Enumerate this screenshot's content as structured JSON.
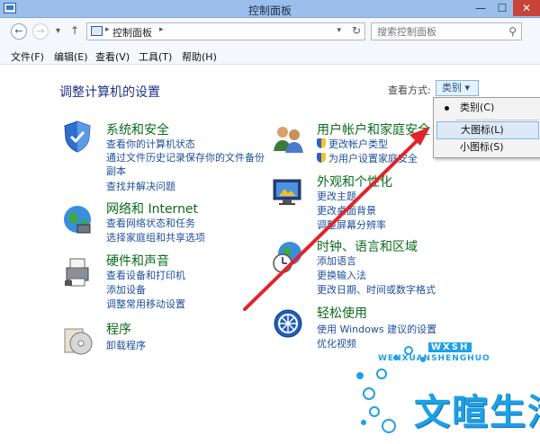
{
  "window": {
    "title": "控制面板",
    "minimize": "—",
    "maximize": "☐",
    "close": "✕"
  },
  "address": {
    "crumb": "控制面板",
    "sep1": "▸",
    "sep2": "▸"
  },
  "search": {
    "placeholder": "搜索控制面板"
  },
  "menu": {
    "file": "文件(F)",
    "edit": "编辑(E)",
    "view": "查看(V)",
    "tools": "工具(T)",
    "help": "帮助(H)"
  },
  "header": {
    "title": "调整计算机的设置",
    "view_by_label": "查看方式:",
    "view_by_value": "类别 ▾"
  },
  "left": [
    {
      "title": "系统和安全",
      "links": [
        "查看你的计算机状态",
        "通过文件历史记录保存你的文件备份",
        "副本",
        "查找并解决问题"
      ]
    },
    {
      "title": "网络和 Internet",
      "links": [
        "查看网络状态和任务",
        "选择家庭组和共享选项"
      ]
    },
    {
      "title": "硬件和声音",
      "links": [
        "查看设备和打印机",
        "添加设备",
        "调整常用移动设置"
      ]
    },
    {
      "title": "程序",
      "links": [
        "卸载程序"
      ]
    }
  ],
  "right": [
    {
      "title": "用户帐户和家庭安全",
      "links": [
        "更改帐户类型",
        "为用户设置家庭安全"
      ]
    },
    {
      "title": "外观和个性化",
      "links": [
        "更改主题",
        "更改桌面背景",
        "调整屏幕分辨率"
      ]
    },
    {
      "title": "时钟、语言和区域",
      "links": [
        "添加语言",
        "更换输入法",
        "更改日期、时间或数字格式"
      ]
    },
    {
      "title": "轻松使用",
      "links": [
        "使用 Windows 建议的设置",
        "优化视频"
      ]
    }
  ],
  "popup": {
    "options": [
      "类别(C)",
      "大图标(L)",
      "小图标(S)"
    ],
    "selected": "类别(C)",
    "highlighted": "大图标(L)"
  },
  "watermark": {
    "title": "文暄生活",
    "subtitle": "WENXUANSHENGHUO",
    "mono": "WXSH"
  },
  "colors": {
    "accent_link": "#1e4e9c",
    "category_title": "#0a6b1c",
    "heading": "#1e3287",
    "arrow": "#e0242a"
  }
}
